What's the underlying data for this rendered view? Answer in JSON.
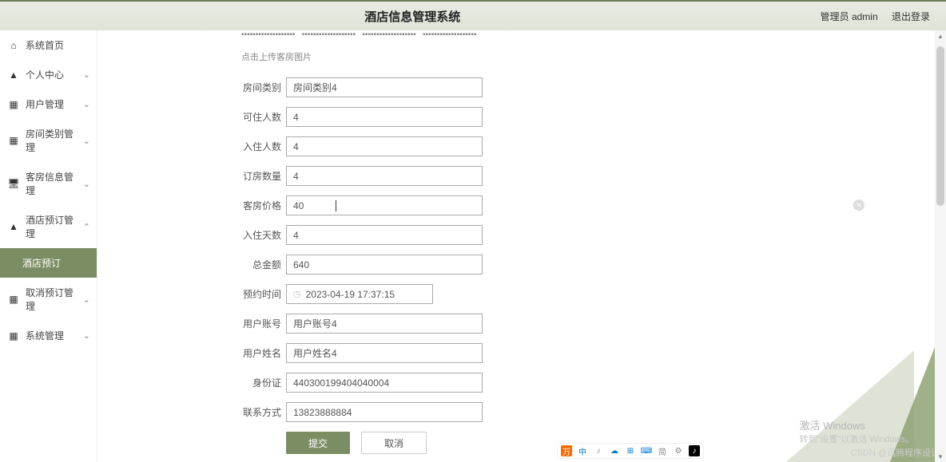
{
  "header": {
    "title": "酒店信息管理系统",
    "admin_label": "管理员 admin",
    "logout_label": "退出登录"
  },
  "sidebar": {
    "items": [
      {
        "icon": "home",
        "label": "系统首页",
        "expandable": false
      },
      {
        "icon": "user",
        "label": "个人中心",
        "expandable": true
      },
      {
        "icon": "grid",
        "label": "用户管理",
        "expandable": true
      },
      {
        "icon": "grid",
        "label": "房间类别管理",
        "expandable": true
      },
      {
        "icon": "monitor",
        "label": "客房信息管理",
        "expandable": true
      },
      {
        "icon": "user",
        "label": "酒店预订管理",
        "expandable": true,
        "open": true
      },
      {
        "icon": "",
        "label": "酒店预订",
        "active": true
      },
      {
        "icon": "grid",
        "label": "取消预订管理",
        "expandable": true
      },
      {
        "icon": "grid",
        "label": "系统管理",
        "expandable": true
      }
    ]
  },
  "form": {
    "upload_tip": "点击上传客房图片",
    "fields": {
      "room_type": {
        "label": "房间类别",
        "value": "房间类别4"
      },
      "capacity": {
        "label": "可住人数",
        "value": "4"
      },
      "occupants": {
        "label": "入住人数",
        "value": "4"
      },
      "rooms": {
        "label": "订房数量",
        "value": "4"
      },
      "price": {
        "label": "客房价格",
        "value": "40"
      },
      "days": {
        "label": "入住天数",
        "value": "4"
      },
      "total": {
        "label": "总金额",
        "value": "640"
      },
      "reserve_time": {
        "label": "预约时间",
        "value": "2023-04-19 17:37:15"
      },
      "account": {
        "label": "用户账号",
        "value": "用户账号4"
      },
      "name": {
        "label": "用户姓名",
        "value": "用户姓名4"
      },
      "idcard": {
        "label": "身份证",
        "value": "440300199404040004"
      },
      "phone": {
        "label": "联系方式",
        "value": "13823888884"
      }
    },
    "submit_label": "提交",
    "cancel_label": "取消"
  },
  "ime": {
    "items": [
      "中",
      "♪",
      "☁",
      "⊞",
      "⌨",
      "简",
      "⚙",
      "♪"
    ]
  },
  "watermark": {
    "line1": "激活 Windows",
    "line2": "转到\"设置\"以激活 Windows。"
  },
  "csdn": "CSDN @迅腾程序设计"
}
